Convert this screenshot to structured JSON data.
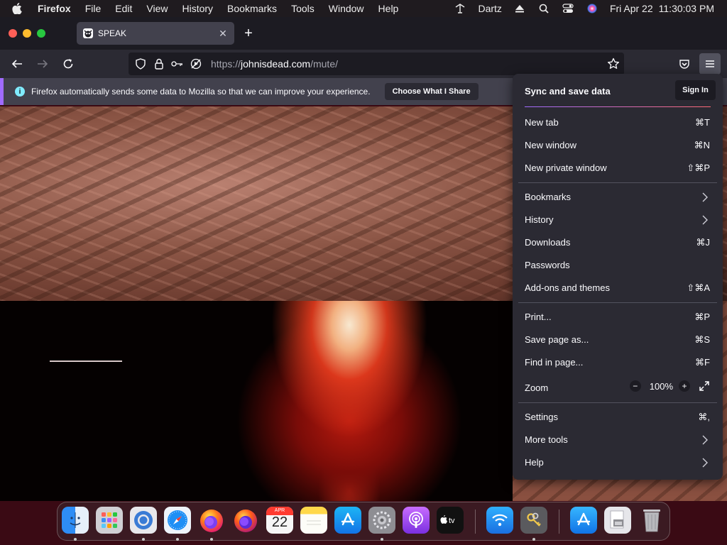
{
  "menubar": {
    "app": "Firefox",
    "items": [
      "File",
      "Edit",
      "View",
      "History",
      "Bookmarks",
      "Tools",
      "Window",
      "Help"
    ],
    "user": "Dartz",
    "date": "Fri Apr 22",
    "time": "11:30:03 PM"
  },
  "tabs": [
    {
      "title": "SPEAK"
    }
  ],
  "navbar": {
    "url_prefix": "https://",
    "url_domain": "johnisdead.com",
    "url_path": "/mute/"
  },
  "notification": {
    "message": "Firefox automatically sends some data to Mozilla so that we can improve your experience.",
    "button": "Choose What I Share"
  },
  "app_menu": {
    "sync_title": "Sync and save data",
    "sign_in": "Sign In",
    "items": [
      {
        "label": "New tab",
        "shortcut": "⌘T"
      },
      {
        "label": "New window",
        "shortcut": "⌘N"
      },
      {
        "label": "New private window",
        "shortcut": "⇧⌘P"
      },
      {
        "label": "Bookmarks",
        "submenu": true
      },
      {
        "label": "History",
        "submenu": true
      },
      {
        "label": "Downloads",
        "shortcut": "⌘J"
      },
      {
        "label": "Passwords",
        "shortcut": ""
      },
      {
        "label": "Add-ons and themes",
        "shortcut": "⇧⌘A"
      },
      {
        "label": "Print...",
        "shortcut": "⌘P"
      },
      {
        "label": "Save page as...",
        "shortcut": "⌘S"
      },
      {
        "label": "Find in page...",
        "shortcut": "⌘F"
      },
      {
        "label": "Zoom",
        "zoom": "100%"
      },
      {
        "label": "Settings",
        "shortcut": "⌘,"
      },
      {
        "label": "More tools",
        "submenu": true
      },
      {
        "label": "Help",
        "submenu": true
      }
    ]
  },
  "dock": {
    "calendar_month": "APR",
    "calendar_day": "22",
    "apps": [
      "Finder",
      "Launchpad",
      "Chromium",
      "Safari",
      "Firefox",
      "Firefox Developer Edition",
      "Calendar",
      "Notes",
      "App Store",
      "System Preferences",
      "Podcasts",
      "TV",
      "Wireless Diagnostics",
      "Keychain Access",
      "Downloads",
      "Documents",
      "Trash"
    ]
  },
  "colors": {
    "accent": "#a06bff",
    "toolbar": "#2b2a33",
    "tabstrip": "#1c1b22"
  }
}
